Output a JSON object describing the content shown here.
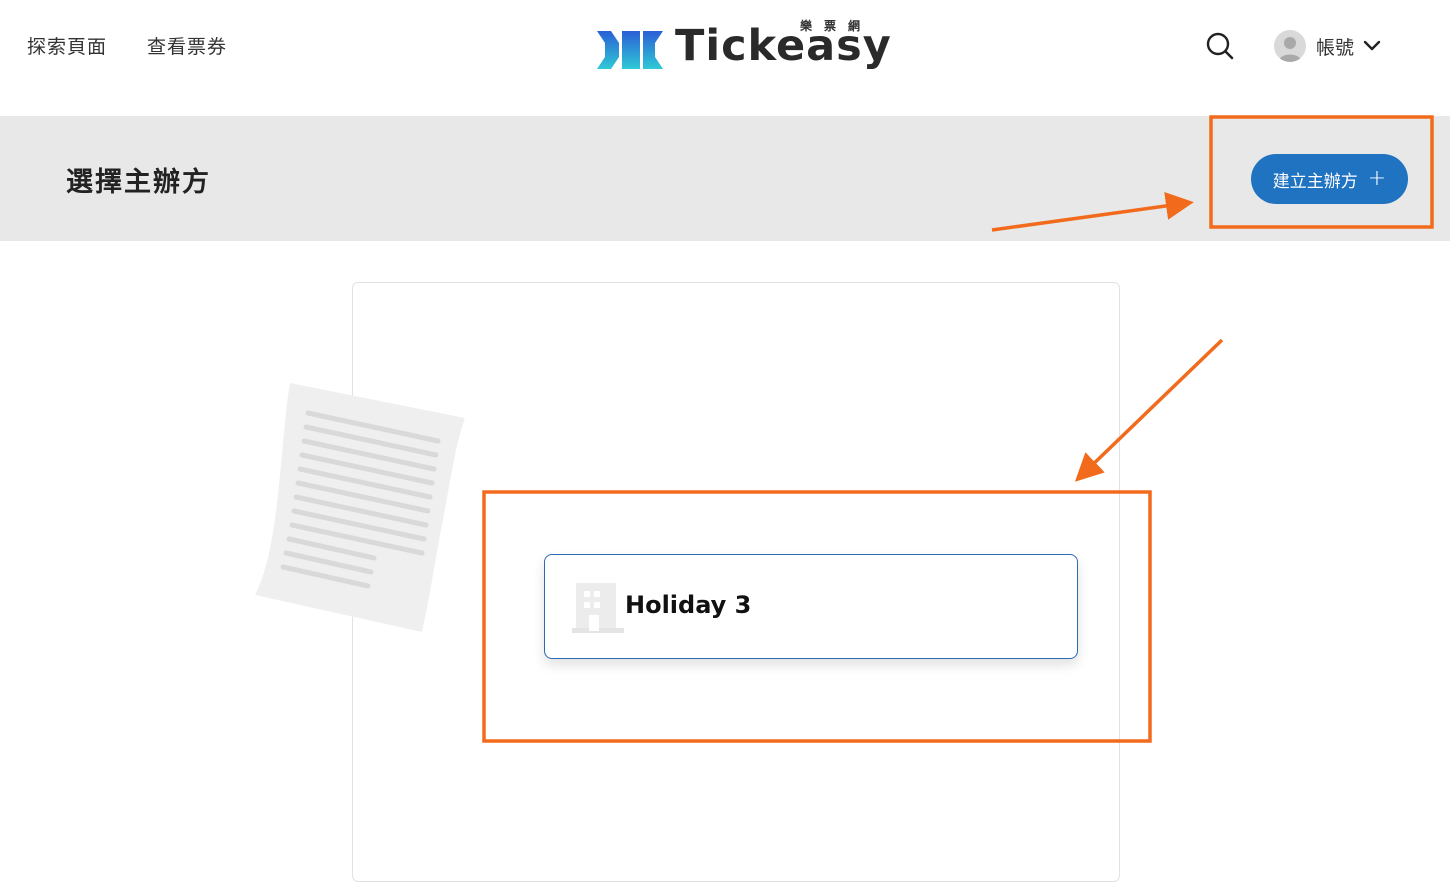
{
  "nav": {
    "explore": "探索頁面",
    "tickets": "查看票券",
    "account": "帳號"
  },
  "logo": {
    "text": "Tickeasy",
    "sub": "樂票網"
  },
  "header": {
    "title": "選擇主辦方",
    "create_button": "建立主辦方",
    "create_icon": "+"
  },
  "organizers": [
    {
      "name": "Holiday 3"
    }
  ],
  "colors": {
    "primary": "#1f73c1",
    "annotation": "#f26a1b",
    "titlebar_bg": "#e8e8e8"
  },
  "icons": {
    "search": "search-icon",
    "avatar": "avatar-icon",
    "dropdown": "chevron-down-icon",
    "organizer": "building-icon",
    "illustration": "document-illustration"
  }
}
